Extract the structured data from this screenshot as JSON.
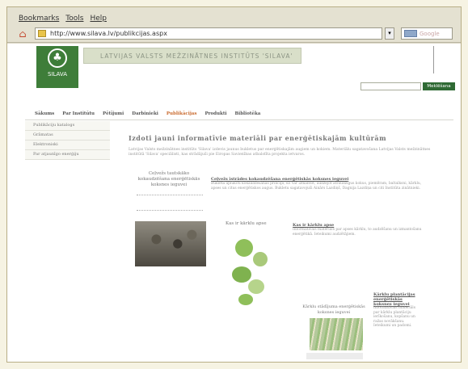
{
  "menubar": {
    "items": [
      "Bookmarks",
      "Tools",
      "Help"
    ]
  },
  "toolbar": {
    "url": "http://www.silava.lv/publikcijas.aspx",
    "search_placeholder": "Google"
  },
  "site": {
    "logo_text": "SILAVA",
    "banner": "LATVIJAS VALSTS MEŽZINĀTNES INSTITŪTS 'SILAVA'",
    "search_button": "Meklēšana"
  },
  "nav": {
    "items": [
      "Sākums",
      "Par Institūtu",
      "Pētījumi",
      "Darbinieki",
      "Publikācijas",
      "Produkti",
      "Bibliotēka"
    ],
    "active": "Publikācijas"
  },
  "sidebar": {
    "items": [
      "Publikāciju katalogs",
      "Grāmatas",
      "Elektroniski",
      "Par atjaunīgo enerģiju"
    ]
  },
  "content": {
    "title": "Izdoti jauni informatīvie materiāli par enerģētiskajām kultūrām",
    "intro": "Latvijas Valsts mežzinātnes institūts 'Silava' izdevis jaunus bukletus par enerģētiskajām augiem un kokiem. Materiālu sagatavošana Latvijas Valsts mežzinātnes institūtā 'Silava' speciālisti, kas strādājuši pie Eiropas Savienības atbalstīta projekta ietvaros.",
    "b1_caption": "Ceļvežs tautskāko kokaudzēšana enerģētiskās koksnes ieguvei",
    "b1_title": "Ceļvežs īstrādes kokaudzēšana enerģētiskās koksnes ieguvei",
    "b1_text": "Bukletā aplūkoti kokaudzēšanas principi, ko var izmantot, audzējot ātraudzīgus kokus, piemēram, baltalksni, kārklu, apses un citus enerģētiskos augus. Bukletu sagatavojuši Ainārs Lazdiņš, Dagnija Lazdiņa un citi Institūta zinātnieki.",
    "b2_caption": "Kas ir kārklu apse",
    "b2_title": "Kas ir kārklu apse",
    "b2_text": "Informatīvais materiāls par apses kārklu, to audzēšanu un izmantošanu enerģētikā. Ieteikumi audzētājiem.",
    "b3_caption": "Kārklu stādījuma enerģētiskās koksnes ieguvei",
    "b3_title": "Kārklu plantācijas enerģētiskās koksnes ieguvei",
    "b3_text": "Informatīvais materiāls par kārklu plantāciju ierīkošanu, kopšanu un ražas novākšanu. Ieteikumi un padomi."
  }
}
